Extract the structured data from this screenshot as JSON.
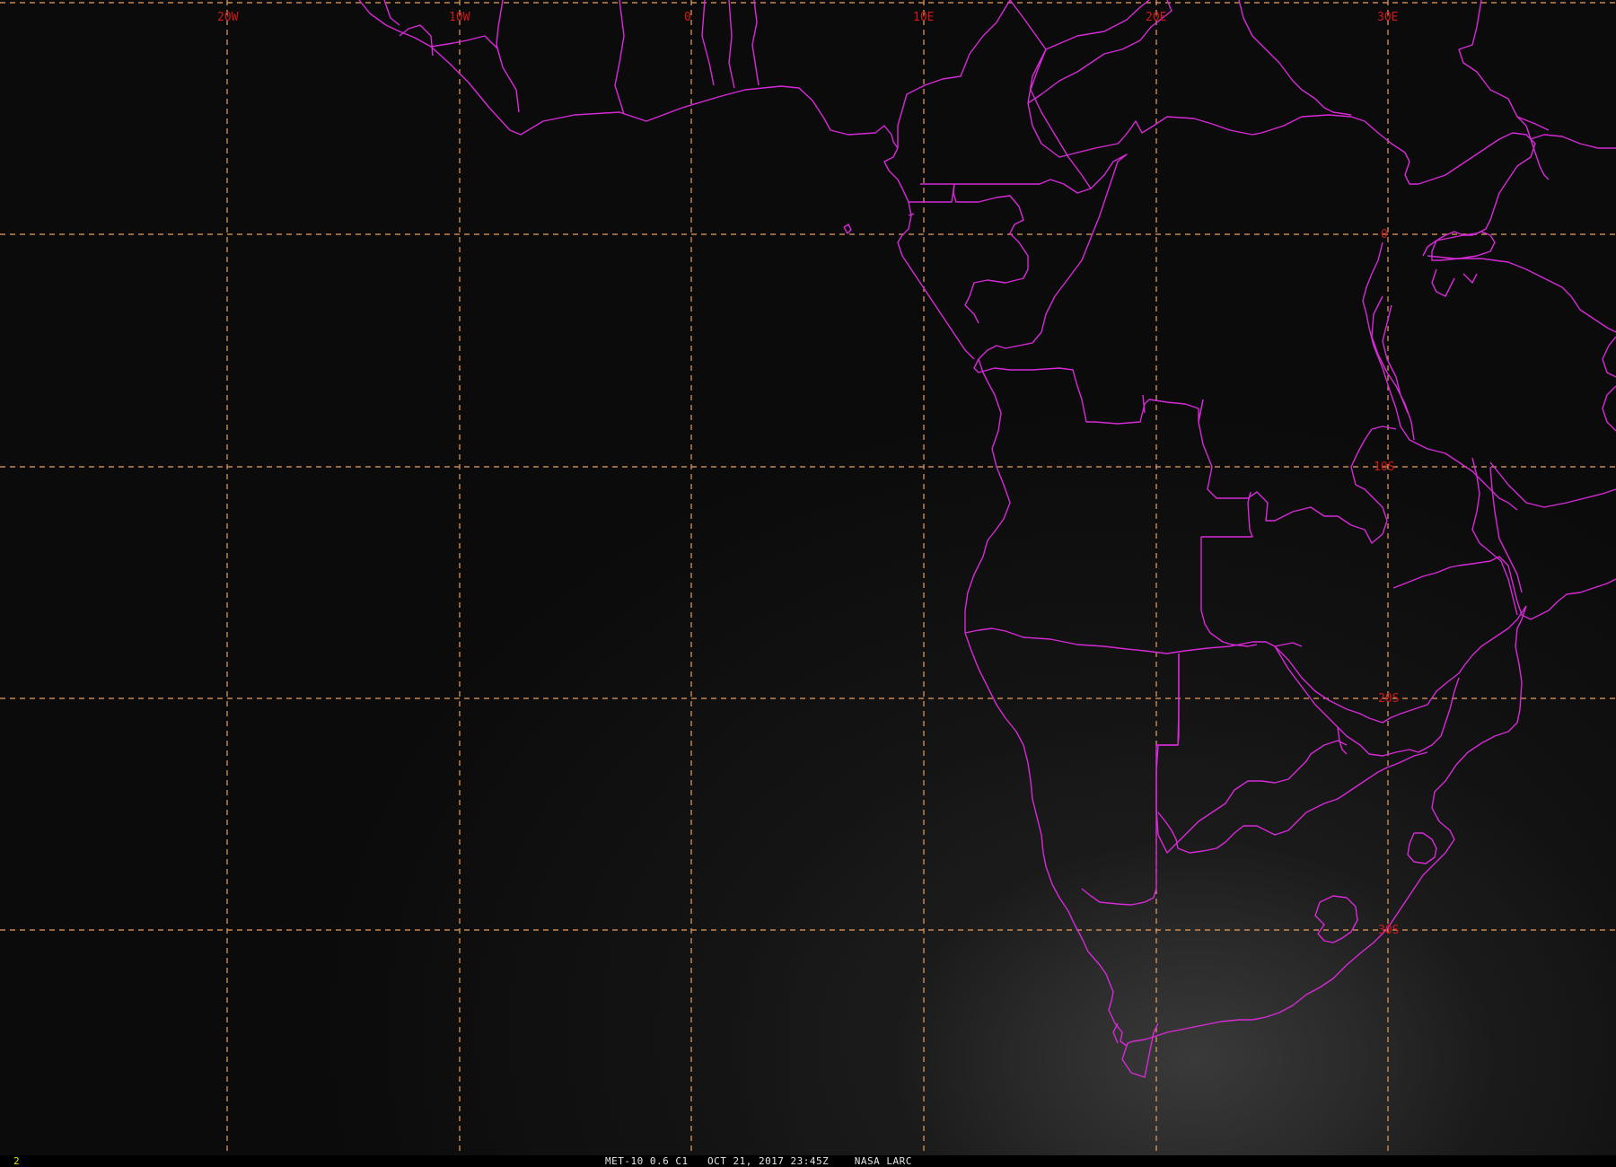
{
  "viewer": {
    "frame_number": "2",
    "caption": "MET-10 0.6 C1   OCT 21, 2017 23:45Z    NASA LARC"
  },
  "grid": {
    "longitude_labels": [
      "20W",
      "10W",
      "0",
      "10E",
      "20E",
      "30E"
    ],
    "latitude_labels": [
      "0",
      "10S",
      "20S",
      "30S"
    ]
  },
  "colors": {
    "borders": "#d72ad7",
    "grid": "#e8a060",
    "grid_labels": "#d01818",
    "frame_number": "#e8e800",
    "caption": "#e6e6e6"
  }
}
